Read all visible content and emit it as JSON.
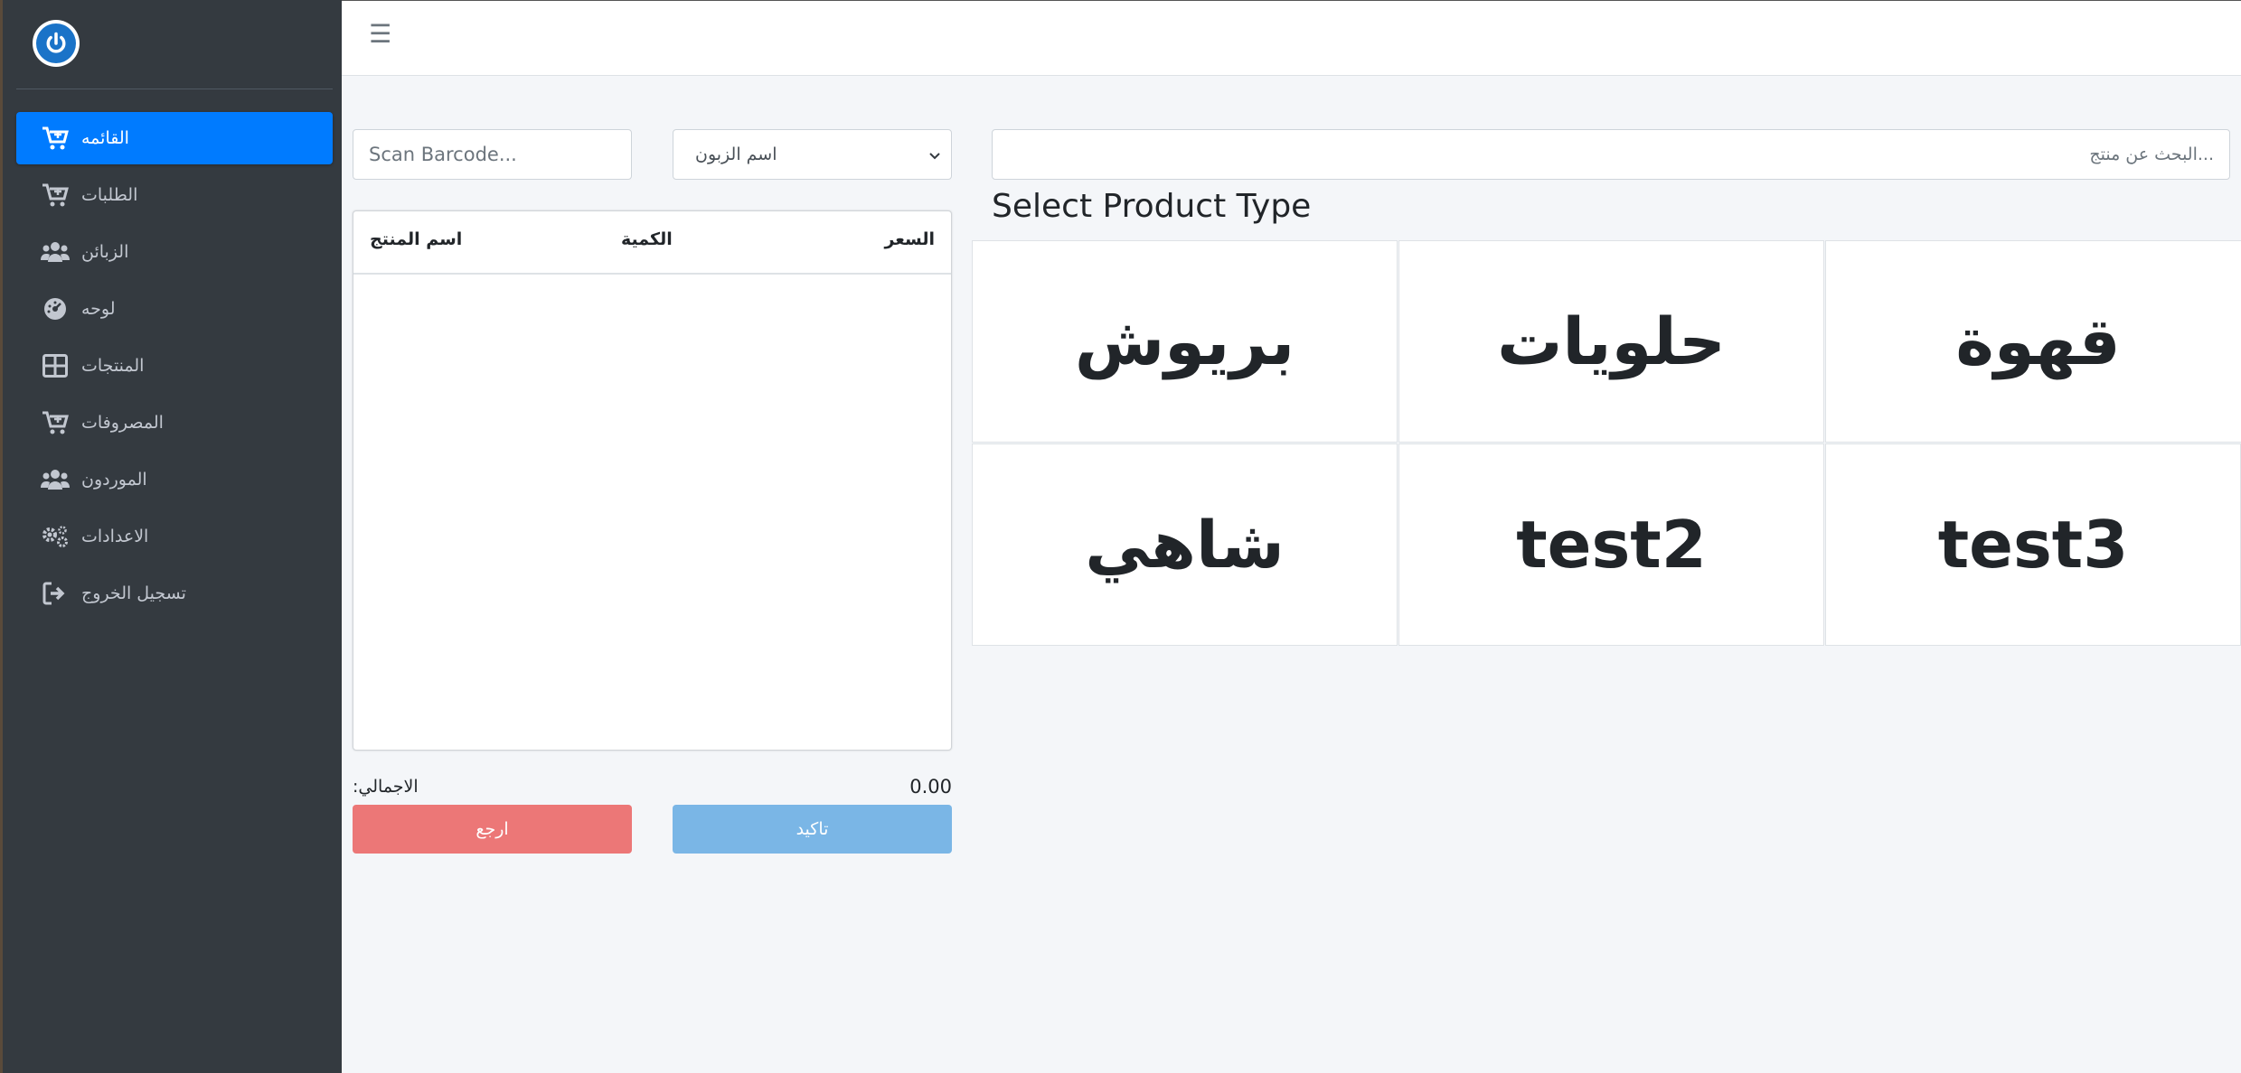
{
  "sidebar": {
    "items": [
      {
        "label": "القائمه",
        "icon": "cart-plus-icon",
        "active": true
      },
      {
        "label": "الطلبات",
        "icon": "cart-plus-icon"
      },
      {
        "label": "الزبائن",
        "icon": "users-icon"
      },
      {
        "label": "لوحه",
        "icon": "dashboard-icon"
      },
      {
        "label": "المنتجات",
        "icon": "grid-icon"
      },
      {
        "label": "المصروفات",
        "icon": "cart-plus-icon"
      },
      {
        "label": "الموردون",
        "icon": "users-icon"
      },
      {
        "label": "الاعدادات",
        "icon": "gears-icon"
      },
      {
        "label": "تسجيل الخروج",
        "icon": "sign-out-icon"
      }
    ]
  },
  "toolbar": {
    "barcode_placeholder": "Scan Barcode...",
    "customer_select": "اسم الزبون",
    "search_placeholder": "...البحث عن منتج"
  },
  "cart": {
    "headers": {
      "name": "اسم المنتج",
      "quantity": "الكمية",
      "price": "السعر"
    },
    "total_label": ":الاجمالي",
    "total_value": "0.00",
    "cancel_label": "ارجع",
    "confirm_label": "تاكيد"
  },
  "products": {
    "heading": "Select Product Type",
    "types": [
      "بريوش",
      "حلويات",
      "قهوة",
      "شاهي",
      "test2",
      "test3"
    ]
  },
  "colors": {
    "primary": "#007bff",
    "danger": "#ec7777",
    "info": "#7ab6e6",
    "sidebar": "#343a40"
  }
}
